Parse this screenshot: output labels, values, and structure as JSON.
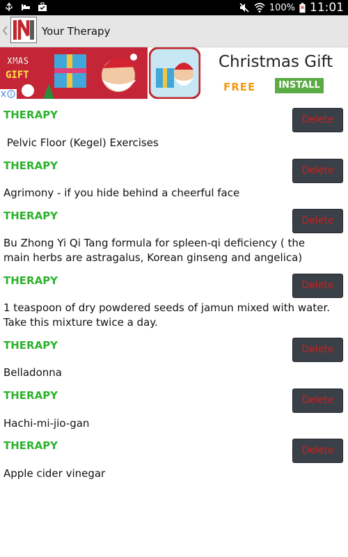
{
  "status_bar": {
    "battery_percent": "100%",
    "time": "11:01",
    "icons": [
      "usb-icon",
      "alarm-bed-icon",
      "bag-check-icon",
      "mute-icon",
      "wifi-icon",
      "battery-icon"
    ]
  },
  "action_bar": {
    "title": "Your Therapy",
    "logo_icon": "app-logo-icon"
  },
  "ad": {
    "title": "Christmas Gift",
    "free_label": "FREE",
    "install_label": "INSTALL",
    "art_text": "XMAS GIFT",
    "colors": {
      "free": "#f39c12",
      "install_bg": "#5aab45"
    }
  },
  "list": {
    "delete_label": "Delete",
    "items": [
      {
        "label": "THERAPY",
        "text": " Pelvic Floor (Kegel) Exercises"
      },
      {
        "label": "THERAPY",
        "text": "Agrimony - if you hide behind a cheerful face"
      },
      {
        "label": "THERAPY",
        "text": "Bu Zhong Yi Qi Tang formula for spleen-qi deficiency ( the main herbs are astragalus, Korean ginseng and angelica)"
      },
      {
        "label": "THERAPY",
        "text": "1 teaspoon of dry powdered seeds of jamun mixed with water. Take this mixture twice a day."
      },
      {
        "label": "THERAPY",
        "text": "Belladonna"
      },
      {
        "label": "THERAPY",
        "text": "Hachi-mi-jio-gan"
      },
      {
        "label": "THERAPY",
        "text": "Apple cider vinegar"
      }
    ],
    "colors": {
      "label": "#2db22d",
      "delete_text": "#cc2020",
      "delete_bg": "#3a4047"
    }
  }
}
